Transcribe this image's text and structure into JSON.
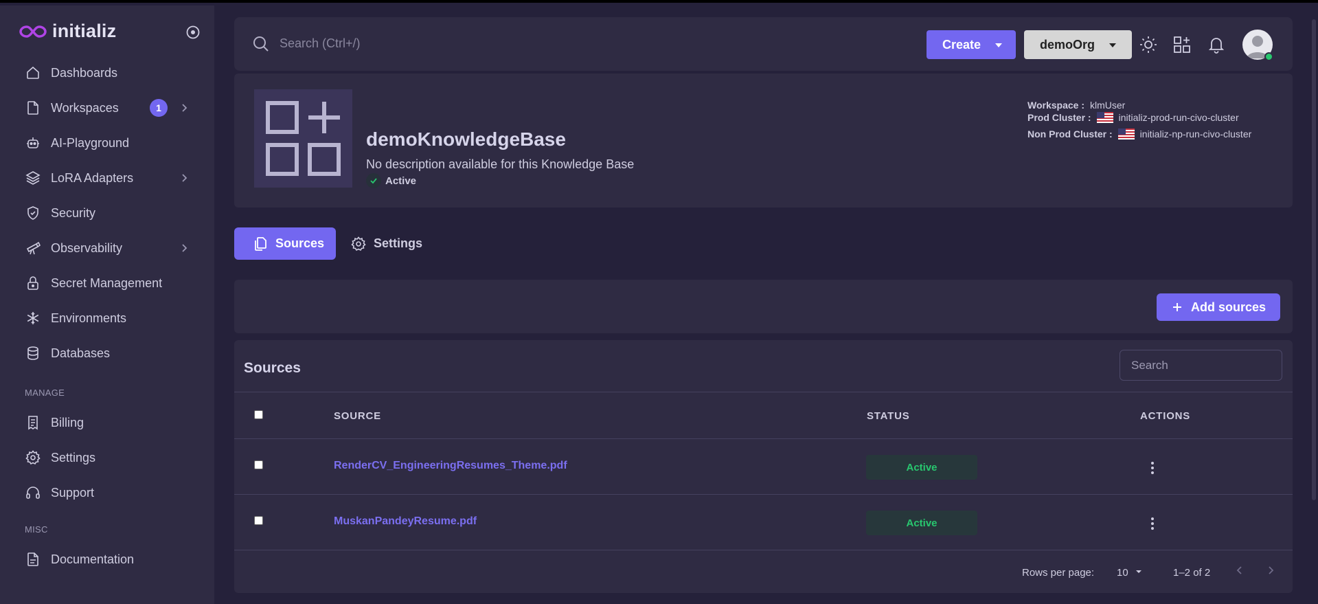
{
  "brand": {
    "name": "initializ"
  },
  "sidebar": {
    "items": [
      {
        "label": "Dashboards"
      },
      {
        "label": "Workspaces",
        "badge": "1"
      },
      {
        "label": "AI-Playground"
      },
      {
        "label": "LoRA Adapters"
      },
      {
        "label": "Security"
      },
      {
        "label": "Observability"
      },
      {
        "label": "Secret Management"
      },
      {
        "label": "Environments"
      },
      {
        "label": "Databases"
      }
    ],
    "manage_label": "MANAGE",
    "manage_items": [
      {
        "label": "Billing"
      },
      {
        "label": "Settings"
      },
      {
        "label": "Support"
      }
    ],
    "misc_label": "MISC",
    "misc_items": [
      {
        "label": "Documentation"
      }
    ]
  },
  "topbar": {
    "search_placeholder": "Search (Ctrl+/)",
    "create_label": "Create",
    "org_label": "demoOrg"
  },
  "kb": {
    "title": "demoKnowledgeBase",
    "description": "No description available for this Knowledge Base",
    "status": "Active",
    "workspace_label": "Workspace :",
    "workspace_value": "klmUser",
    "prod_label": "Prod Cluster :",
    "prod_value": "initializ-prod-run-civo-cluster",
    "nonprod_label": "Non Prod Cluster :",
    "nonprod_value": "initializ-np-run-civo-cluster"
  },
  "tabs": {
    "sources": "Sources",
    "settings": "Settings"
  },
  "add_sources_label": "Add sources",
  "table": {
    "title": "Sources",
    "search_placeholder": "Search",
    "columns": {
      "source": "SOURCE",
      "status": "STATUS",
      "actions": "ACTIONS"
    },
    "rows": [
      {
        "source": "RenderCV_EngineeringResumes_Theme.pdf",
        "status": "Active"
      },
      {
        "source": "MuskanPandeyResume.pdf",
        "status": "Active"
      }
    ],
    "rows_per_page_label": "Rows per page:",
    "rows_per_page": "10",
    "range": "1–2 of 2"
  },
  "colors": {
    "accent": "#7367f0",
    "success": "#28c76f",
    "background": "#25213a",
    "card": "#2f2b43"
  }
}
